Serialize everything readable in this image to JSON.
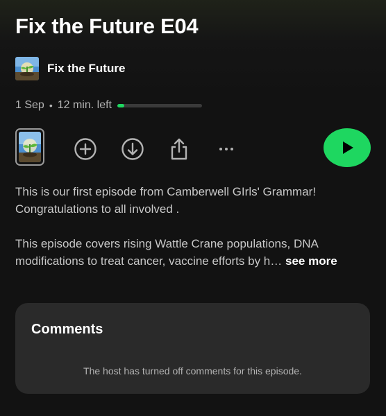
{
  "episode": {
    "title": "Fix the Future E04",
    "show_name": "Fix the Future",
    "date": "1 Sep",
    "separator": "•",
    "time_left": "12 min. left",
    "progress": 0.08
  },
  "actions": {
    "cover_icon": "episode-cover-thumbnail",
    "add_icon": "add-circle-icon",
    "download_icon": "download-circle-icon",
    "share_icon": "share-icon",
    "more_icon": "more-options-icon",
    "more_label": "···",
    "play_icon": "play-icon"
  },
  "description": {
    "paragraph1": "This is our first episode from Camberwell GIrls' Grammar! Congratulations to all involved .",
    "paragraph2": "This episode covers rising Wattle Crane populations, DNA modifications to treat cancer, vaccine efforts by h…",
    "see_more": "see more"
  },
  "comments": {
    "title": "Comments",
    "note": "The host has turned off comments for this episode."
  },
  "colors": {
    "accent": "#1ed760",
    "background": "#121212",
    "card": "#2a2a2a",
    "secondary_text": "#b3b3b3"
  }
}
